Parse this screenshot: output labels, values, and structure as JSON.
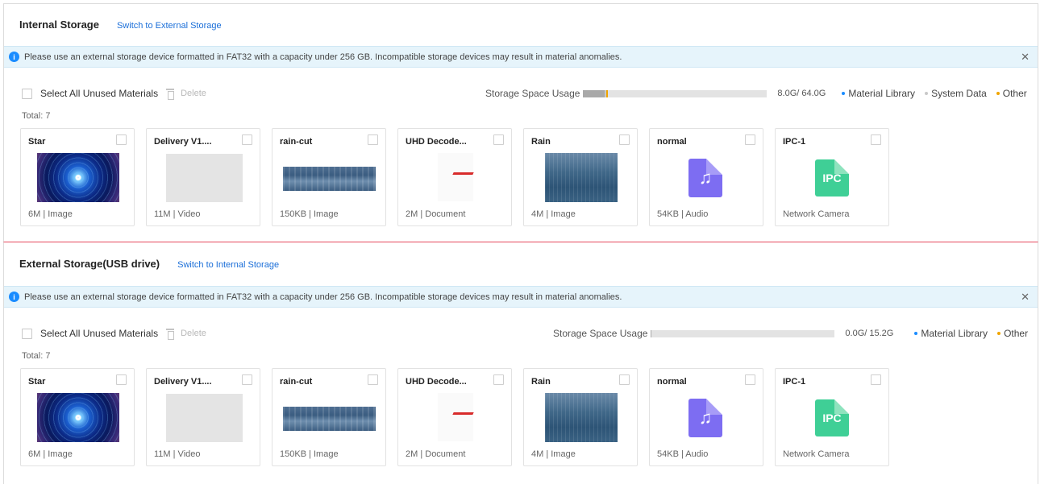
{
  "internal": {
    "title": "Internal Storage",
    "switch_link": "Switch to External Storage",
    "notice": "Please use an external storage device formatted in FAT32 with a capacity under 256 GB. Incompatible storage devices may result in material anomalies.",
    "select_all": "Select All Unused Materials",
    "delete": "Delete",
    "usage_label": "Storage Space Usage",
    "usage_value": "8.0G/ 64.0G",
    "usage_fractions": {
      "material_library": 0.12,
      "system_data": 0.01,
      "other": 0.005
    },
    "legend": [
      "Material Library",
      "System Data",
      "Other"
    ],
    "total": "Total: 7"
  },
  "external": {
    "title": "External Storage(USB drive)",
    "switch_link": "Switch to Internal Storage",
    "notice": "Please use an external storage device formatted in FAT32 with a capacity under 256 GB. Incompatible storage devices may result in material anomalies.",
    "select_all": "Select All Unused Materials",
    "delete": "Delete",
    "usage_label": "Storage Space Usage",
    "usage_value": "0.0G/ 15.2G",
    "usage_fractions": {
      "material_library": 0.003,
      "other": 0.0
    },
    "legend": [
      "Material Library",
      "Other"
    ],
    "total": "Total: 7"
  },
  "materials": [
    {
      "title": "Star",
      "meta": "6M | Image",
      "thumb": "star"
    },
    {
      "title": "Delivery V1....",
      "meta": "11M | Video",
      "thumb": "video"
    },
    {
      "title": "rain-cut",
      "meta": "150KB | Image",
      "thumb": "rain-cut"
    },
    {
      "title": "UHD Decode...",
      "meta": "2M | Document",
      "thumb": "doc"
    },
    {
      "title": "Rain",
      "meta": "4M | Image",
      "thumb": "rain"
    },
    {
      "title": "normal",
      "meta": "54KB | Audio",
      "thumb": "audio"
    },
    {
      "title": "IPC-1",
      "meta": "Network Camera",
      "thumb": "ipc"
    }
  ],
  "icons": {
    "audio_glyph": "♫",
    "ipc_glyph": "IPC",
    "info_glyph": "i",
    "close_glyph": "✕"
  },
  "colors": {
    "link": "#1a6ed8",
    "material_library": "#1a8cff",
    "system_data": "#c8c8c8",
    "other": "#f0a500",
    "bar_fill_internal": "#a9a9a9",
    "section_divider": "#e5485d"
  }
}
